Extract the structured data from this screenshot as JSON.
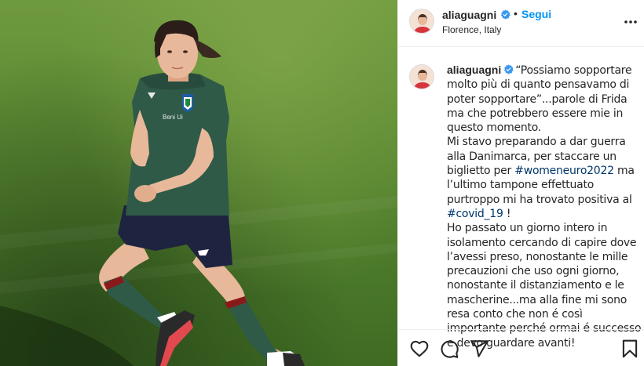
{
  "post": {
    "username": "aliaguagni",
    "follow_label": "Segui",
    "separator": "•",
    "location": "Florence, Italy",
    "caption": {
      "username": "aliaguagni",
      "part1": "“Possiamo sopportare molto più di quanto pensavamo di poter sopportare”...parole di Frida ma che potrebbero essere mie in questo momento.\nMi stavo preparando a dar guerra alla Danimarca, per staccare un biglietto per ",
      "hashtag1": "#womeneuro2022",
      "part2": " ma l’ultimo tampone effettuato purtroppo mi ha trovato positiva al ",
      "hashtag2": "#covid_19",
      "part3": " !\nHo passato un giorno intero in isolamento cercando di capire dove l’avessi preso, nonostante le mille precauzioni che uso ogni giorno, nonostante il distanziamento e le mascherine...ma alla fine mi sono resa conto che non é così importante perché ormai é successo e devo guardare avanti!"
    },
    "shirt_text": "Beni Ui"
  },
  "icons": {
    "verified": "verified-badge-icon",
    "more": "more-options-icon",
    "like": "heart-icon",
    "comment": "comment-icon",
    "share": "paper-plane-icon",
    "save": "bookmark-icon"
  },
  "colors": {
    "link": "#0095f6",
    "hashtag": "#00376b",
    "text": "#262626",
    "border": "#efefef",
    "pitch": "#5c8a33",
    "kit": "#2f5a48"
  }
}
